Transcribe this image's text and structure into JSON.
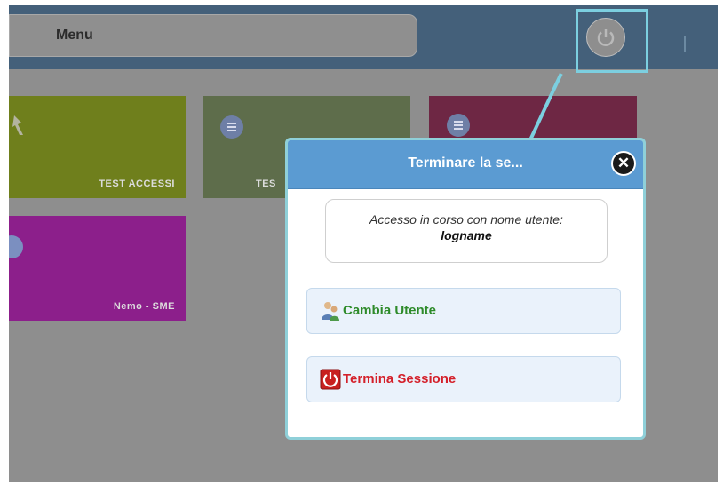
{
  "header": {
    "menu_label": "Menu"
  },
  "tiles": [
    {
      "label": "TEST ACCESSI",
      "color": "#6f7f1c"
    },
    {
      "label": "TES",
      "color": "#5e6d4b"
    },
    {
      "label": "",
      "color": "#6e2744"
    },
    {
      "label": "Nemo - SME",
      "color": "#8c1f8b"
    }
  ],
  "dialog": {
    "title": "Terminare la se...",
    "user_prompt": "Accesso in corso con nome utente:",
    "username": "logname",
    "change_user_label": "Cambia Utente",
    "end_session_label": "Termina Sessione"
  },
  "icons": {
    "power": "power-icon",
    "close": "close-icon",
    "change_user": "users-icon",
    "end_session": "power-off-icon"
  },
  "colors": {
    "header_blue": "#5b9bd2",
    "highlight": "#7ccfe0",
    "change_user_text": "#2e8b2a",
    "end_session_text": "#d4202a"
  }
}
